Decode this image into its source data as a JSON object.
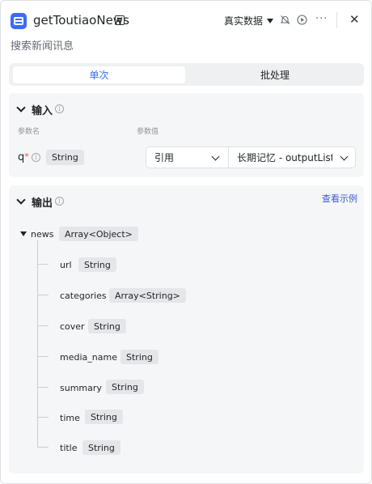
{
  "header": {
    "title": "getToutiaoNews",
    "mode": "真实数据",
    "more": "···",
    "close": "✕"
  },
  "subtitle": "搜索新闻讯息",
  "tabs": [
    {
      "label": "单次",
      "active": true
    },
    {
      "label": "批处理",
      "active": false
    }
  ],
  "input_section": {
    "title": "输入",
    "col_param_name": "参数名",
    "col_param_value": "参数值",
    "param": {
      "name": "q",
      "required_mark": "*",
      "type": "String",
      "source": "引用",
      "value": "长期记忆 - outputList"
    }
  },
  "output_section": {
    "title": "输出",
    "view_example": "查看示例",
    "root": {
      "name": "news",
      "type": "Array<Object>"
    },
    "children": [
      {
        "name": "url",
        "type": "String"
      },
      {
        "name": "categories",
        "type": "Array<String>"
      },
      {
        "name": "cover",
        "type": "String"
      },
      {
        "name": "media_name",
        "type": "String"
      },
      {
        "name": "summary",
        "type": "String"
      },
      {
        "name": "time",
        "type": "String"
      },
      {
        "name": "title",
        "type": "String"
      }
    ]
  },
  "colors": {
    "accent": "#3b6cf6",
    "link": "#3b5ccc",
    "required": "#f54a45",
    "section_bg": "#f5f6f7"
  }
}
